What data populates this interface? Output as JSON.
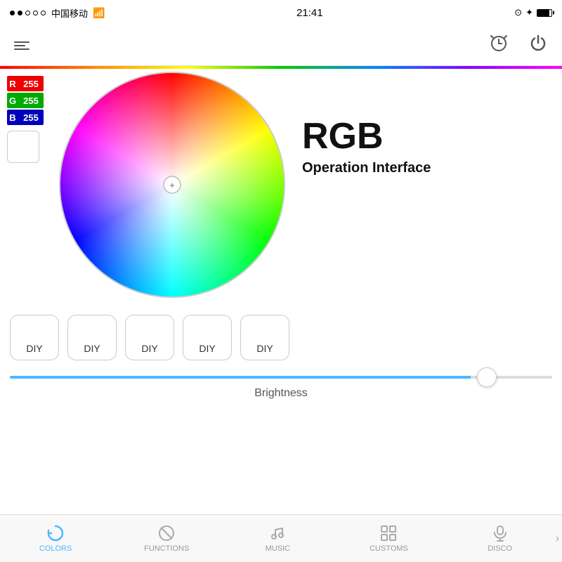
{
  "statusBar": {
    "carrier": "中国移动",
    "time": "21:41",
    "lockIcon": "⊙",
    "btIcon": "✦"
  },
  "nav": {
    "menuLabel": "menu",
    "alarmLabel": "alarm",
    "powerLabel": "power"
  },
  "rgb": {
    "r_label": "R",
    "g_label": "G",
    "b_label": "B",
    "r_value": "255",
    "g_value": "255",
    "b_value": "255"
  },
  "rightPanel": {
    "title": "RGB",
    "subtitle": "Operation Interface"
  },
  "diyButtons": [
    {
      "label": "DIY"
    },
    {
      "label": "DIY"
    },
    {
      "label": "DIY"
    },
    {
      "label": "DIY"
    },
    {
      "label": "DIY"
    }
  ],
  "brightness": {
    "label": "Brightness",
    "value": 85
  },
  "tabs": [
    {
      "id": "colors",
      "label": "COLORS",
      "active": true
    },
    {
      "id": "functions",
      "label": "FUNCTIONS",
      "active": false
    },
    {
      "id": "music",
      "label": "MUSIC",
      "active": false
    },
    {
      "id": "customs",
      "label": "CUSTOMS",
      "active": false
    },
    {
      "id": "disco",
      "label": "DISCO",
      "active": false
    }
  ]
}
